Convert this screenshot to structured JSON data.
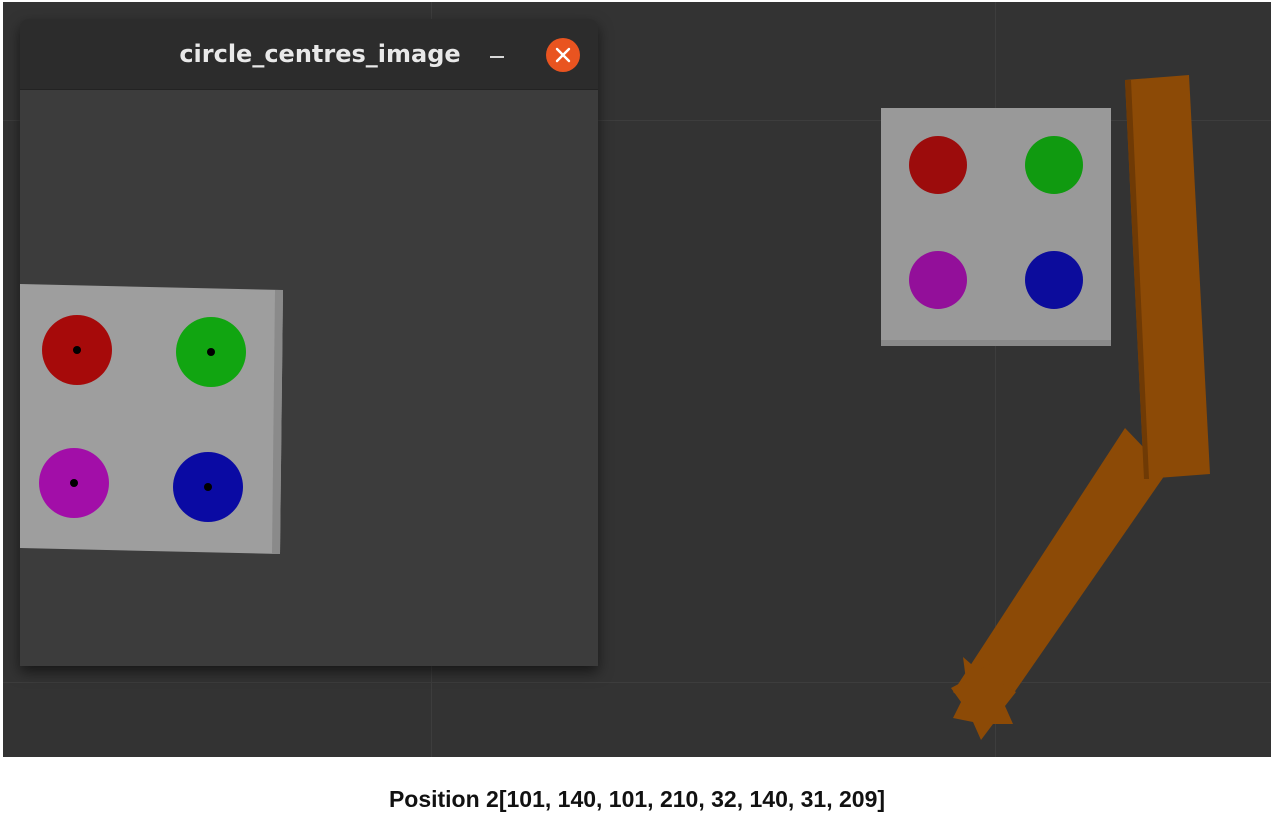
{
  "window": {
    "title": "circle_centres_image",
    "minimize_label": "–",
    "close_icon": "close-icon"
  },
  "detected_image": {
    "markers": [
      {
        "name": "red",
        "color": "#a60a0a"
      },
      {
        "name": "green",
        "color": "#11a511"
      },
      {
        "name": "purple",
        "color": "#a20ea8"
      },
      {
        "name": "blue",
        "color": "#0a0aa3"
      }
    ],
    "centre_dot_color": "#000000"
  },
  "sim_scene": {
    "background_color": "#333333",
    "grid_color": "#3d3d3d",
    "plate_color": "#999999",
    "arm_color": "#8c4a06",
    "markers": [
      {
        "name": "red",
        "color": "#9c0c0c"
      },
      {
        "name": "green",
        "color": "#109a10"
      },
      {
        "name": "purple",
        "color": "#930f9a"
      },
      {
        "name": "blue",
        "color": "#0c0c9c"
      }
    ]
  },
  "caption": {
    "text": "Position 2[101, 140, 101, 210, 32, 140, 31, 209]"
  }
}
